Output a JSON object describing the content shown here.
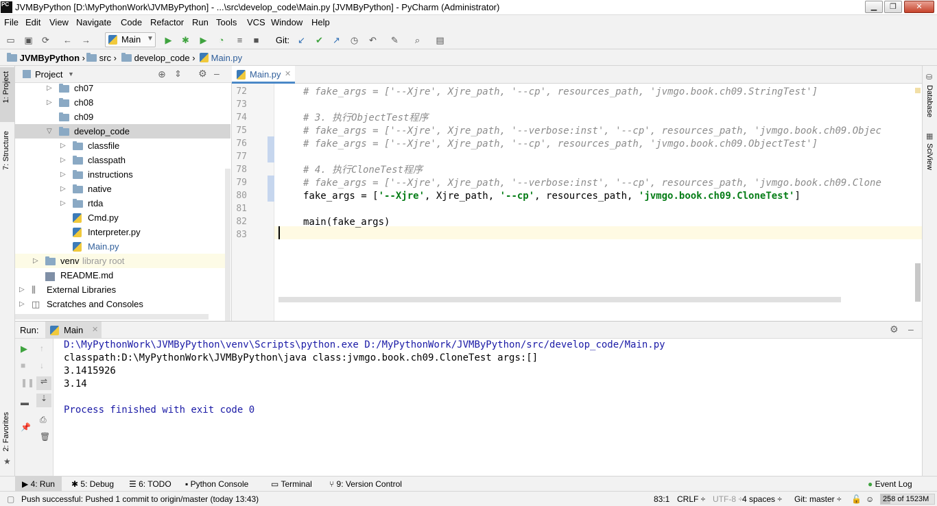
{
  "window": {
    "title": "JVMByPython [D:\\MyPythonWork\\JVMByPython] - ...\\src\\develop_code\\Main.py [JVMByPython] - PyCharm (Administrator)",
    "app_icon": "PC"
  },
  "menu": [
    "File",
    "Edit",
    "View",
    "Navigate",
    "Code",
    "Refactor",
    "Run",
    "Tools",
    "VCS",
    "Window",
    "Help"
  ],
  "toolbar": {
    "run_config": "Main",
    "git_label": "Git:"
  },
  "breadcrumb": [
    "JVMByPython",
    "src",
    "develop_code",
    "Main.py"
  ],
  "left_tabs": {
    "project": "1: Project",
    "structure": "7: Structure",
    "favorites": "2: Favorites"
  },
  "right_tabs": {
    "database": "Database",
    "sciview": "SciView"
  },
  "project_panel": {
    "title": "Project",
    "tree": [
      {
        "label": "ch07",
        "type": "folder",
        "expandable": true
      },
      {
        "label": "ch08",
        "type": "folder",
        "expandable": true
      },
      {
        "label": "ch09",
        "type": "folder",
        "expandable": false
      },
      {
        "label": "develop_code",
        "type": "folder",
        "expanded": true
      },
      {
        "label": "classfile",
        "type": "folder",
        "expandable": true
      },
      {
        "label": "classpath",
        "type": "folder",
        "expandable": true
      },
      {
        "label": "instructions",
        "type": "folder",
        "expandable": true
      },
      {
        "label": "native",
        "type": "folder",
        "expandable": true
      },
      {
        "label": "rtda",
        "type": "folder",
        "expandable": true
      },
      {
        "label": "Cmd.py",
        "type": "py"
      },
      {
        "label": "Interpreter.py",
        "type": "py"
      },
      {
        "label": "Main.py",
        "type": "py"
      },
      {
        "label": "venv",
        "suffix": "library root",
        "type": "folder",
        "expandable": true
      },
      {
        "label": "README.md",
        "type": "md"
      },
      {
        "label": "External Libraries",
        "type": "lib",
        "expandable": true
      },
      {
        "label": "Scratches and Consoles",
        "type": "scratch",
        "expandable": true
      }
    ]
  },
  "editor": {
    "tab": "Main.py",
    "lines": [
      {
        "n": "72",
        "parts": [
          {
            "t": "# fake_args = ['--Xjre', Xjre_path, '--cp', resources_path, 'jvmgo.book.ch09.StringTest']",
            "c": "cm"
          }
        ]
      },
      {
        "n": "73",
        "parts": []
      },
      {
        "n": "74",
        "parts": [
          {
            "t": "# 3. 执行ObjectTest程序",
            "c": "cm"
          }
        ]
      },
      {
        "n": "75",
        "parts": [
          {
            "t": "# fake_args = ['--Xjre', Xjre_path, '--verbose:inst', '--cp', resources_path, 'jvmgo.book.ch09.Objec",
            "c": "cm"
          }
        ]
      },
      {
        "n": "76",
        "parts": [
          {
            "t": "# fake_args = ['--Xjre', Xjre_path, '--cp', resources_path, 'jvmgo.book.ch09.ObjectTest']",
            "c": "cm"
          }
        ]
      },
      {
        "n": "77",
        "parts": []
      },
      {
        "n": "78",
        "parts": [
          {
            "t": "# 4. 执行CloneTest程序",
            "c": "cm"
          }
        ]
      },
      {
        "n": "79",
        "parts": [
          {
            "t": "# fake_args = ['--Xjre', Xjre_path, '--verbose:inst', '--cp', resources_path, 'jvmgo.book.ch09.Clone",
            "c": "cm"
          }
        ]
      },
      {
        "n": "80",
        "parts": [
          {
            "t": "fake_args = [",
            "c": ""
          },
          {
            "t": "'--Xjre'",
            "c": "st"
          },
          {
            "t": ", Xjre_path, ",
            "c": ""
          },
          {
            "t": "'--cp'",
            "c": "st"
          },
          {
            "t": ", resources_path, ",
            "c": ""
          },
          {
            "t": "'jvmgo.book.ch09.CloneTest'",
            "c": "st"
          },
          {
            "t": "]",
            "c": ""
          }
        ]
      },
      {
        "n": "81",
        "parts": []
      },
      {
        "n": "82",
        "parts": [
          {
            "t": "main(fake_args)",
            "c": ""
          }
        ]
      },
      {
        "n": "83",
        "parts": []
      }
    ]
  },
  "run_panel": {
    "label": "Run:",
    "tab": "Main",
    "output": [
      {
        "t": "D:\\MyPythonWork\\JVMByPython\\venv\\Scripts\\python.exe D:/MyPythonWork/JVMByPython/src/develop_code/Main.py",
        "color": "#1a1aa6"
      },
      {
        "t": "classpath:D:\\MyPythonWork\\JVMByPython\\java class:jvmgo.book.ch09.CloneTest args:[]",
        "color": "#000000"
      },
      {
        "t": "3.1415926",
        "color": "#000000"
      },
      {
        "t": "3.14",
        "color": "#000000"
      },
      {
        "t": "",
        "color": "#000000"
      },
      {
        "t": "Process finished with exit code 0",
        "color": "#1a1aa6"
      }
    ]
  },
  "bottom_tabs": [
    "4: Run",
    "5: Debug",
    "6: TODO",
    "Python Console",
    "Terminal",
    "9: Version Control"
  ],
  "event_log": "Event Log",
  "status": {
    "message": "Push successful: Pushed 1 commit to origin/master (today 13:43)",
    "position": "83:1",
    "line_sep": "CRLF ÷",
    "encoding": "UTF-8 ÷",
    "indent": "4 spaces ÷",
    "vcs": "Git: master ÷",
    "memory": "258 of 1523M"
  },
  "colors": {
    "accent": "#4a88c7",
    "selection": "#d5d5d5",
    "comment": "#8c8c8c",
    "string": "#067d17",
    "output_blue": "#1a1aa6"
  }
}
